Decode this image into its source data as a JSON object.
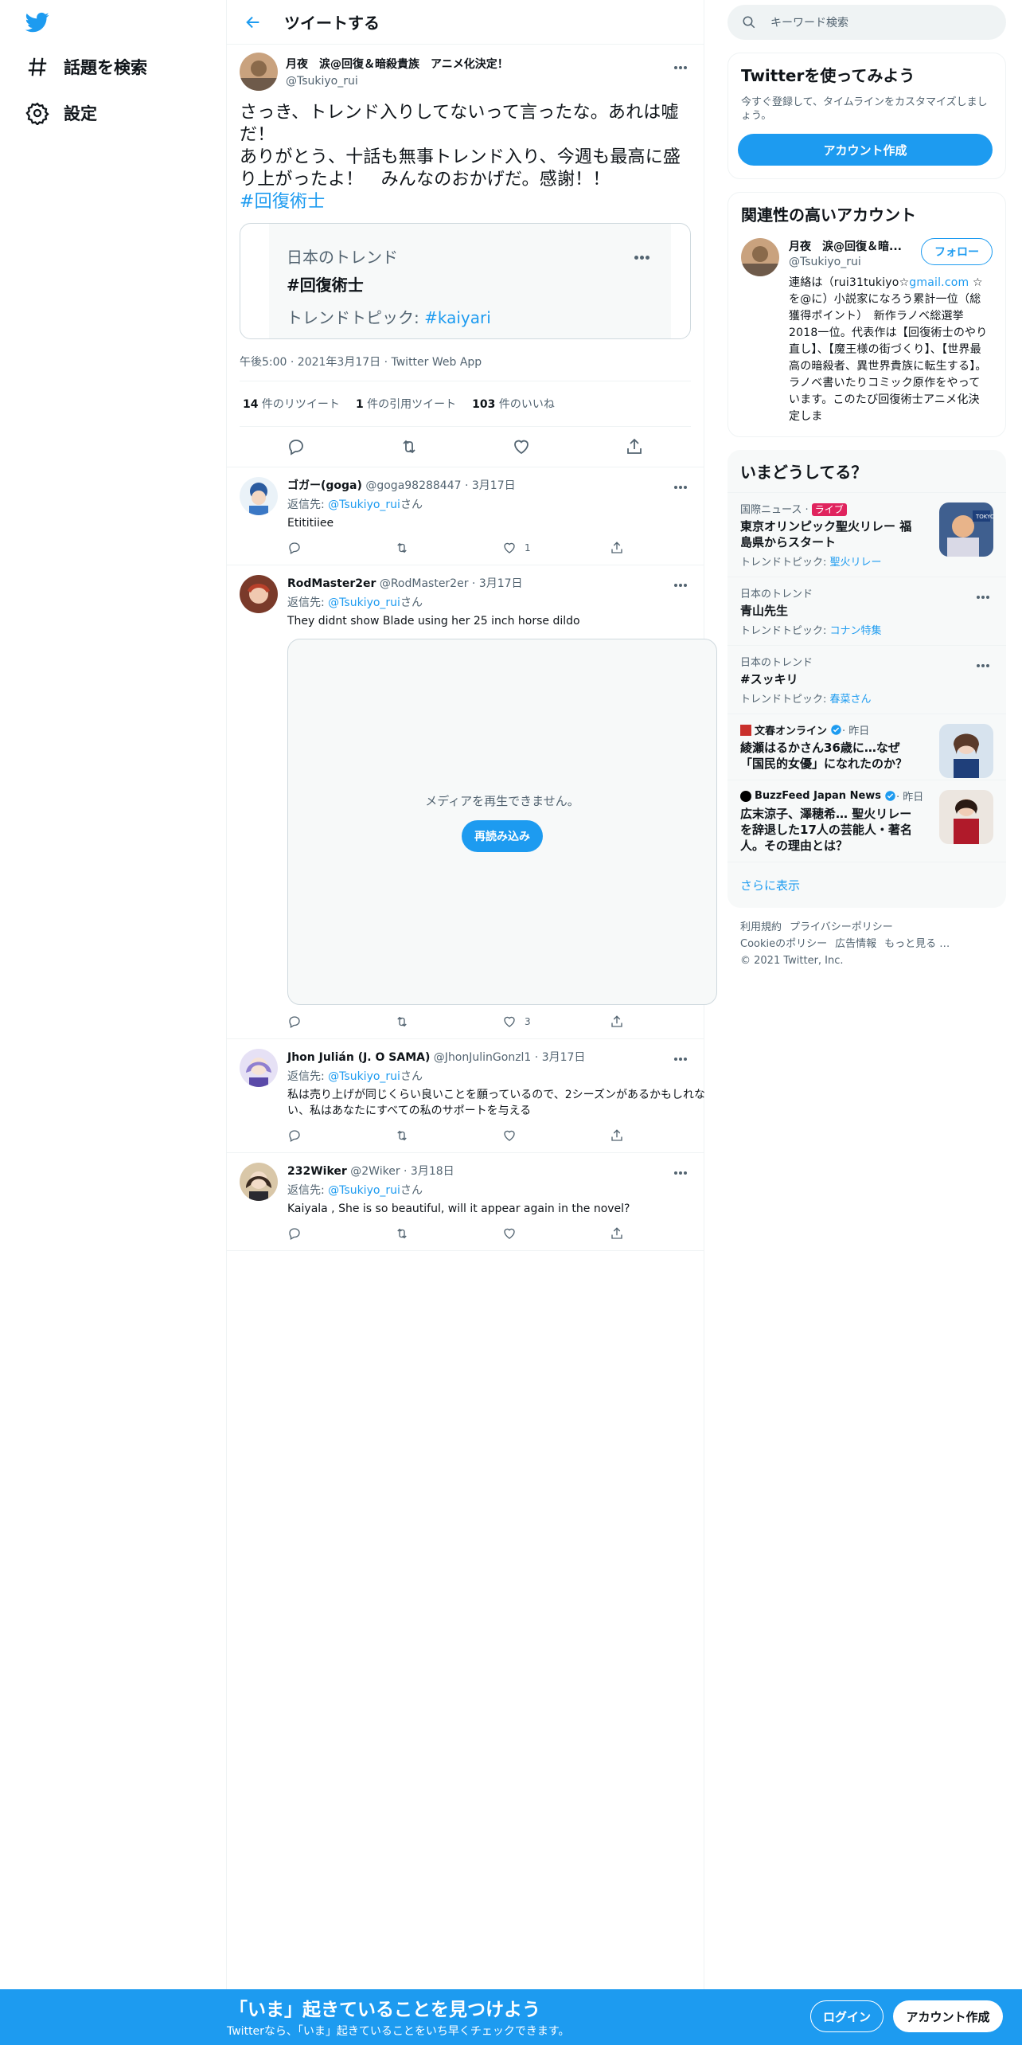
{
  "nav": {
    "explore_label": "話題を検索",
    "settings_label": "設定"
  },
  "header": {
    "title": "ツイートする"
  },
  "main_tweet": {
    "name": "月夜　涙@回復＆暗殺貴族　アニメ化決定！",
    "handle": "@Tsukiyo_rui",
    "text": "さっき、トレンド入りしてないって言ったな。あれは嘘だ！\nありがとう、十話も無事トレンド入り、今週も最高に盛り上がったよ！　みんなのおかげだ。感謝！！",
    "hashtag": "#回復術士",
    "card": {
      "kind": "日本のトレンド",
      "name": "#回復術士",
      "topic_prefix": "トレンドトピック: ",
      "topic": "#kaiyari"
    },
    "meta": "午後5:00 · 2021年3月17日 · Twitter Web App",
    "retweets_count": "14",
    "retweets_label": " 件のリツイート",
    "quotes_count": "1",
    "quotes_label": " 件の引用ツイート",
    "likes_count": "103",
    "likes_label": " 件のいいね"
  },
  "replies": [
    {
      "name": "ゴガー(goga)",
      "sub": " @goga98288447 · 3月17日",
      "to_prefix": "返信先: ",
      "to": "@Tsukiyo_rui",
      "to_suffix": "さん",
      "text": "Etititiiee",
      "likes": "1"
    },
    {
      "name": "RodMaster2er",
      "sub": " @RodMaster2er · 3月17日",
      "to_prefix": "返信先: ",
      "to": "@Tsukiyo_rui",
      "to_suffix": "さん",
      "text": "They didnt show Blade using her 25 inch horse dildo",
      "media_msg": "メディアを再生できません。",
      "media_reload": "再読み込み",
      "likes": "3"
    },
    {
      "name": "Jhon Julián (J. O SAMA)",
      "sub": " @JhonJulinGonzl1 · 3月17日",
      "to_prefix": "返信先: ",
      "to": "@Tsukiyo_rui",
      "to_suffix": "さん",
      "text": "私は売り上げが同じくらい良いことを願っているので、2シーズンがあるかもしれない、私はあなたにすべての私のサポートを与える",
      "likes": ""
    },
    {
      "name": "232Wiker",
      "sub": " @2Wiker · 3月18日",
      "to_prefix": "返信先: ",
      "to": "@Tsukiyo_rui",
      "to_suffix": "さん",
      "text": "Kaiyala , She is so beautiful, will it appear again in the novel?",
      "likes": ""
    }
  ],
  "search": {
    "placeholder": "キーワード検索"
  },
  "signup_panel": {
    "title": "Twitterを使ってみよう",
    "desc": "今すぐ登録して、タイムラインをカスタマイズしましょう。",
    "button": "アカウント作成"
  },
  "related": {
    "title": "関連性の高いアカウント",
    "name": "月夜　涙@回復＆暗...",
    "handle": "@Tsukiyo_rui",
    "follow": "フォロー",
    "bio_a": "連絡は（rui31tukiyo☆",
    "bio_link": "gmail.com",
    "bio_b": " ☆を@に）小説家になろう累計一位（総獲得ポイント）　新作ラノベ総選挙2018一位。代表作は【回復術士のやり直し】、【魔王様の街づくり】、【世界最高の暗殺者、異世界貴族に転生する】。ラノベ書いたりコミック原作をやっています。このたび回復術士アニメ化決定しま"
  },
  "trends": {
    "title": "いまどうしてる？",
    "items": [
      {
        "meta": "国際ニュース · ",
        "live": "ライブ",
        "name": "東京オリンピック聖火リレー 福島県からスタート",
        "topic_prefix": "トレンドトピック: ",
        "topic": "聖火リレー"
      },
      {
        "meta": "日本のトレンド",
        "name": "青山先生",
        "topic_prefix": "トレンドトピック: ",
        "topic": "コナン特集"
      },
      {
        "meta": "日本のトレンド",
        "name": "#スッキリ",
        "topic_prefix": "トレンドトピック: ",
        "topic": "春菜さん"
      },
      {
        "source": "文春オンライン",
        "time": " · 昨日",
        "name": "綾瀬はるかさん36歳に…なぜ「国民的女優」になれたのか？"
      },
      {
        "source": "BuzzFeed Japan News",
        "time": " · 昨日",
        "name": "広末涼子、澤穂希… 聖火リレーを辞退した17人の芸能人・著名人。その理由とは？"
      }
    ],
    "show_more": "さらに表示"
  },
  "footer": {
    "terms": "利用規約",
    "privacy": "プライバシーポリシー",
    "cookie": "Cookieのポリシー",
    "ads": "広告情報",
    "more": "もっと見る …",
    "copyright": "© 2021 Twitter, Inc."
  },
  "bottom_bar": {
    "title": "「いま」起きていることを見つけよう",
    "sub": "Twitterなら、「いま」起きていることをいち早くチェックできます。",
    "login": "ログイン",
    "signup": "アカウント作成"
  },
  "colors": {
    "accent": "#1d9bf0",
    "text": "#0f1419",
    "muted": "#536471",
    "live": "#e0245e"
  },
  "icons": [
    "twitter-logo-icon",
    "hashtag-icon",
    "gear-icon",
    "back-arrow-icon",
    "search-icon",
    "reply-icon",
    "retweet-icon",
    "like-icon",
    "share-icon",
    "more-icon",
    "verified-icon"
  ]
}
